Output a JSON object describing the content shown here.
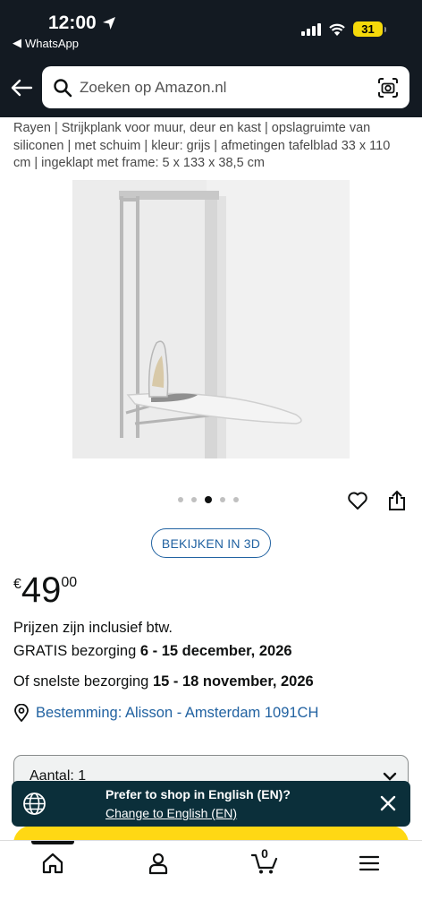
{
  "status_bar": {
    "time": "12:00",
    "back_app": "WhatsApp",
    "battery": "31"
  },
  "search": {
    "placeholder": "Zoeken op Amazon.nl"
  },
  "product": {
    "title": "Rayen | Strijkplank voor muur, deur en kast | opslagruimte van siliconen | met schuim | kleur: grijs | afmetingen tafelblad 33 x 110 cm | ingeklapt met frame: 5 x 133 x 38,5 cm",
    "image_index": 3,
    "image_count": 5,
    "view_3d_label": "BEKIJKEN IN 3D",
    "price": {
      "currency": "€",
      "whole": "49",
      "fraction": "00"
    },
    "vat_note": "Prijzen zijn inclusief btw.",
    "delivery_prefix": "GRATIS bezorging",
    "delivery_dates": "6 - 15 december, 2026",
    "fast_prefix": "Of snelste bezorging",
    "fast_dates": "15 - 18 november, 2026",
    "destination": "Bestemming: Alisson - Amsterdam 1091CH",
    "quantity_label": "Aantal: 1"
  },
  "language_banner": {
    "question": "Prefer to shop in English (EN)?",
    "link": "Change to English (EN)"
  },
  "bottom_nav": {
    "cart_count": "0",
    "items": [
      "home-icon",
      "account-icon",
      "cart-icon",
      "menu-icon"
    ]
  },
  "colors": {
    "header_bg": "#131a22",
    "link_blue": "#2162a1",
    "banner_bg": "#0b2f3a",
    "cart_yellow": "#ffd814",
    "battery_yellow": "#f5d90a"
  }
}
